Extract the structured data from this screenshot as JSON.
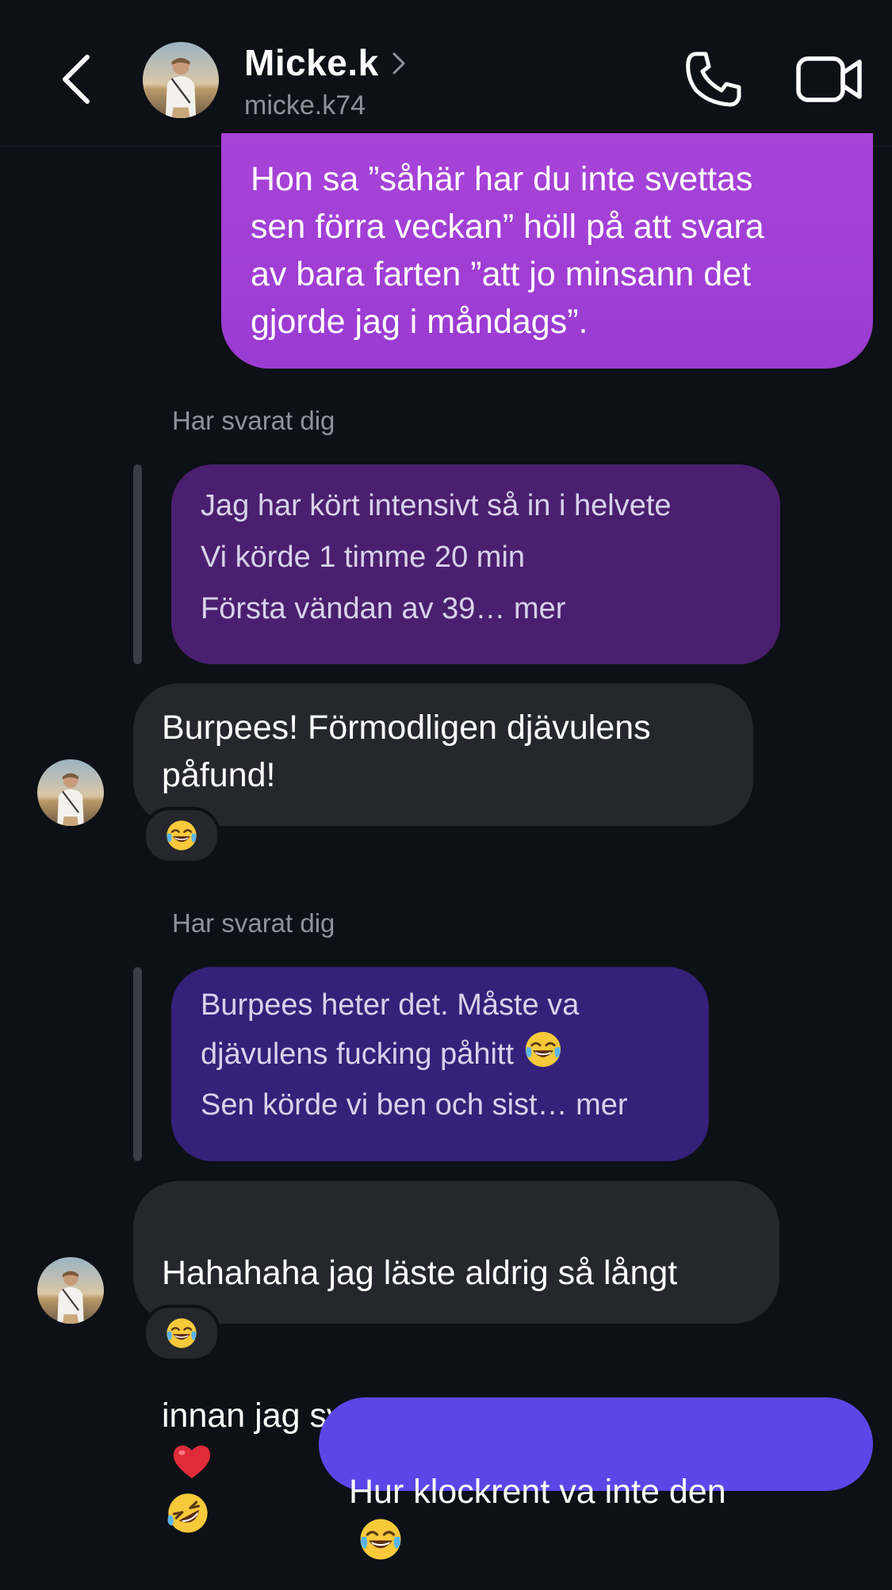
{
  "header": {
    "name": "Micke.k",
    "handle": "micke.k74",
    "icons": [
      "back-chevron-icon",
      "chevron-right-icon",
      "phone-icon",
      "video-camera-icon"
    ]
  },
  "messages": {
    "m1": {
      "text": "Hon sa ”såhär har du inte svettas\nsen förra veckan” höll på att svara\nav bara farten ”att jo minsann det\ngjorde jag i måndags”."
    },
    "reply1": {
      "label": "Har svarat dig",
      "quote_line1": "Jag har kört intensivt så in i helvete",
      "quote_line2": "Vi körde 1 timme 20 min",
      "quote_line3": "Första vändan av 39… mer",
      "text": "Burpees! Förmodligen djävulens\npåfund!",
      "reaction": "laughing-tears-emoji"
    },
    "reply2": {
      "label": "Har svarat dig",
      "quote_line1": "Burpees heter det. Måste va",
      "quote_line2": "djävulens fucking påhitt",
      "quote_line3": "Sen körde vi ben och sist… mer",
      "text_line1": "Hahahaha jag läste aldrig så långt",
      "text_line2": "innan jag svarade!",
      "reaction": "laughing-tears-emoji"
    },
    "m_last": {
      "text": "Hur klockrent va inte den"
    }
  },
  "colors": {
    "background": "#0d1016",
    "sent_gradient": "#a843d8",
    "sent_blue": "#5b47e8",
    "received": "#25272d",
    "quote_purple": "#4b1f6f",
    "quote_indigo": "#35217a"
  }
}
